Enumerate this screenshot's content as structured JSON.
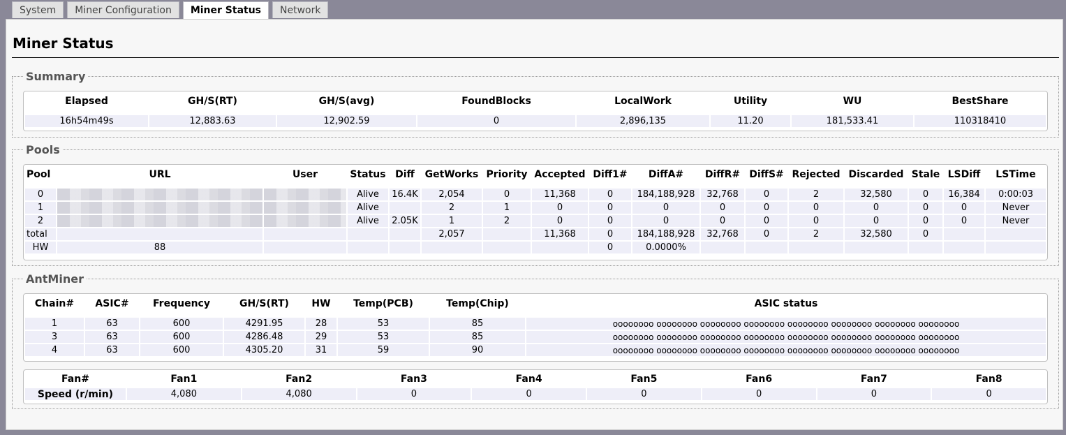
{
  "tabs": [
    "System",
    "Miner Configuration",
    "Miner Status",
    "Network"
  ],
  "active_tab": "Miner Status",
  "page_title": "Miner Status",
  "summary": {
    "legend": "Summary",
    "headers": [
      "Elapsed",
      "GH/S(RT)",
      "GH/S(avg)",
      "FoundBlocks",
      "LocalWork",
      "Utility",
      "WU",
      "BestShare"
    ],
    "row": [
      "16h54m49s",
      "12,883.63",
      "12,902.59",
      "0",
      "2,896,135",
      "11.20",
      "181,533.41",
      "110318410"
    ]
  },
  "pools": {
    "legend": "Pools",
    "headers": [
      "Pool",
      "URL",
      "User",
      "Status",
      "Diff",
      "GetWorks",
      "Priority",
      "Accepted",
      "Diff1#",
      "DiffA#",
      "DiffR#",
      "DiffS#",
      "Rejected",
      "Discarded",
      "Stale",
      "LSDiff",
      "LSTime"
    ],
    "rows": [
      [
        "0",
        "",
        "",
        "Alive",
        "16.4K",
        "2,054",
        "0",
        "11,368",
        "0",
        "184,188,928",
        "32,768",
        "0",
        "2",
        "32,580",
        "0",
        "16,384",
        "0:00:03"
      ],
      [
        "1",
        "",
        "",
        "Alive",
        "",
        "2",
        "1",
        "0",
        "0",
        "0",
        "0",
        "0",
        "0",
        "0",
        "0",
        "0",
        "Never"
      ],
      [
        "2",
        "",
        "",
        "Alive",
        "2.05K",
        "1",
        "2",
        "0",
        "0",
        "0",
        "0",
        "0",
        "0",
        "0",
        "0",
        "0",
        "Never"
      ],
      [
        "total",
        "",
        "",
        "",
        "",
        "2,057",
        "",
        "11,368",
        "0",
        "184,188,928",
        "32,768",
        "0",
        "2",
        "32,580",
        "0",
        "",
        ""
      ]
    ],
    "hw_row": {
      "label": "HW",
      "value": "88",
      "diff1": "0",
      "diffa": "0.0000%"
    }
  },
  "antminer": {
    "legend": "AntMiner",
    "headers": [
      "Chain#",
      "ASIC#",
      "Frequency",
      "GH/S(RT)",
      "HW",
      "Temp(PCB)",
      "Temp(Chip)",
      "ASIC status"
    ],
    "rows": [
      [
        "1",
        "63",
        "600",
        "4291.95",
        "28",
        "53",
        "85",
        "oooooooo oooooooo oooooooo oooooooo oooooooo oooooooo oooooooo oooooooo"
      ],
      [
        "3",
        "63",
        "600",
        "4286.48",
        "29",
        "53",
        "85",
        "oooooooo oooooooo oooooooo oooooooo oooooooo oooooooo oooooooo oooooooo"
      ],
      [
        "4",
        "63",
        "600",
        "4305.20",
        "31",
        "59",
        "90",
        "oooooooo oooooooo oooooooo oooooooo oooooooo oooooooo oooooooo oooooooo"
      ]
    ],
    "fans": {
      "header_label": "Fan#",
      "headers": [
        "Fan1",
        "Fan2",
        "Fan3",
        "Fan4",
        "Fan5",
        "Fan6",
        "Fan7",
        "Fan8"
      ],
      "row_label": "Speed (r/min)",
      "values": [
        "4,080",
        "4,080",
        "0",
        "0",
        "0",
        "0",
        "0",
        "0"
      ]
    }
  }
}
